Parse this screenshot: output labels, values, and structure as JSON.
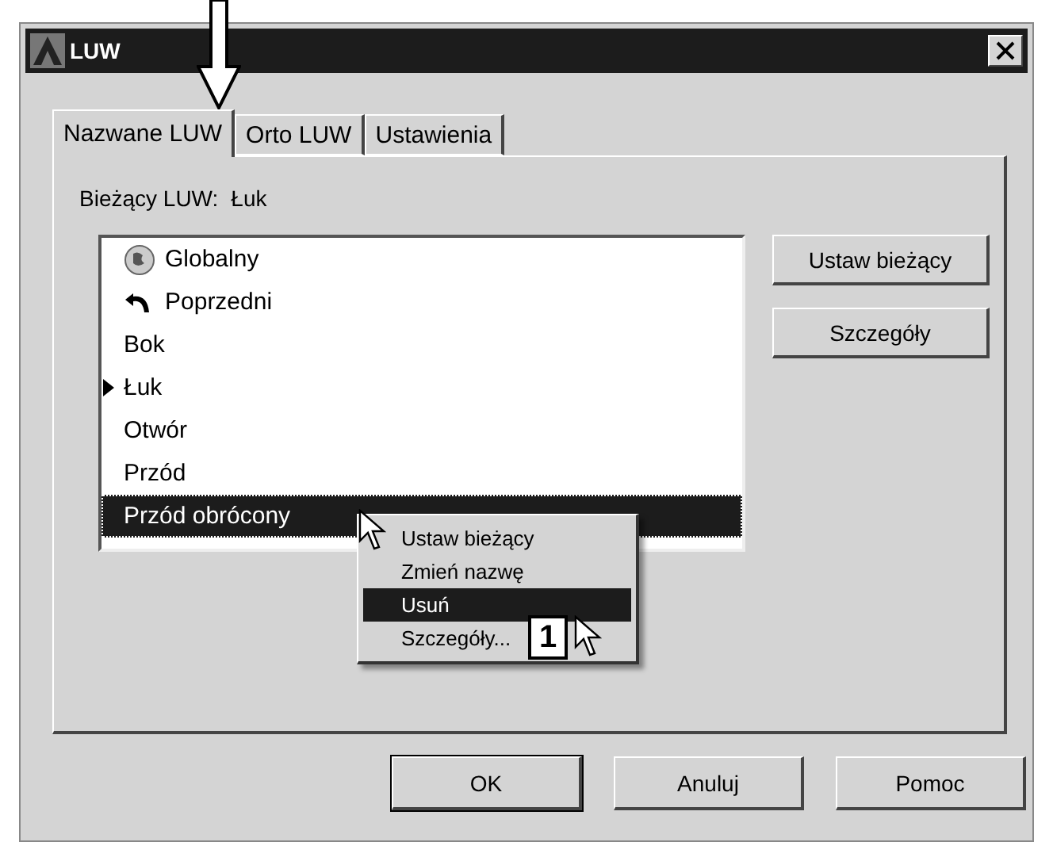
{
  "window": {
    "title": "LUW"
  },
  "tabs": [
    {
      "label": "Nazwane LUW",
      "selected": true
    },
    {
      "label": "Orto LUW",
      "selected": false
    },
    {
      "label": "Ustawienia",
      "selected": false
    }
  ],
  "current": {
    "label": "Bieżący LUW:",
    "value": "Łuk"
  },
  "list": [
    {
      "label": "Globalny",
      "kind": "globe",
      "current": false,
      "selected": false
    },
    {
      "label": "Poprzedni",
      "kind": "previous",
      "current": false,
      "selected": false
    },
    {
      "label": "Bok",
      "kind": "plain",
      "current": false,
      "selected": false
    },
    {
      "label": "Łuk",
      "kind": "plain",
      "current": true,
      "selected": false
    },
    {
      "label": "Otwór",
      "kind": "plain",
      "current": false,
      "selected": false
    },
    {
      "label": "Przód",
      "kind": "plain",
      "current": false,
      "selected": false
    },
    {
      "label": "Przód obrócony",
      "kind": "plain",
      "current": false,
      "selected": true
    }
  ],
  "side_buttons": [
    "Ustaw bieżący",
    "Szczegóły"
  ],
  "context_menu": [
    {
      "label": "Ustaw bieżący",
      "selected": false
    },
    {
      "label": "Zmień nazwę",
      "selected": false
    },
    {
      "label": "Usuń",
      "selected": true
    },
    {
      "label": "Szczegóły...",
      "selected": false
    }
  ],
  "callout": "1",
  "buttons": [
    {
      "label": "OK",
      "default": true
    },
    {
      "label": "Anuluj",
      "default": false
    },
    {
      "label": "Pomoc",
      "default": false
    }
  ]
}
